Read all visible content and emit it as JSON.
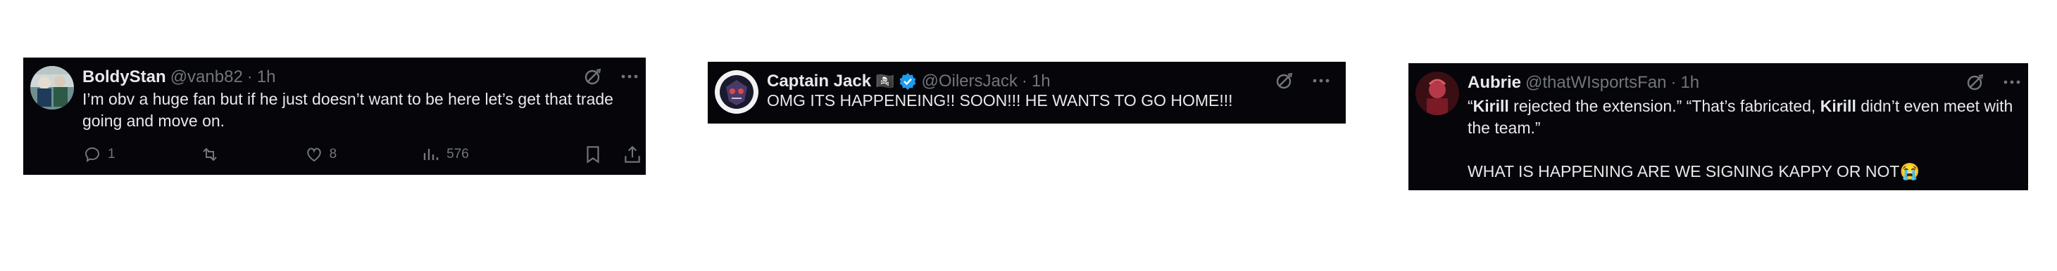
{
  "tweets": [
    {
      "name": "BoldyStan",
      "handle": "@vanb82",
      "separator": "·",
      "time": "1h",
      "text": "I’m obv a huge fan but if he just doesn’t want to be here let’s get that trade going and move on.",
      "metrics": {
        "replies": "1",
        "likes": "8",
        "views": "576"
      }
    },
    {
      "name": "Captain Jack",
      "name_badge": "🏴‍☠️",
      "handle": "@OilersJack",
      "separator": "·",
      "time": "1h",
      "verified": true,
      "text": "OMG ITS HAPPENEING!! SOON!!! HE WANTS TO GO HOME!!!"
    },
    {
      "name": "Aubrie",
      "handle": "@thatWIsportsFan",
      "separator": "·",
      "time": "1h",
      "text_parts": {
        "q1_open": "“",
        "kirill_1": "Kirill",
        "q1_rest": " rejected the extension.” “That’s fabricated, ",
        "kirill_2": "Kirill",
        "q2_rest": " didn’t even meet with the team.”",
        "line2": "WHAT IS HAPPENING ARE WE SIGNING KAPPY OR NOT",
        "emoji": "😭"
      }
    }
  ],
  "icons": {
    "grok": "grok-icon",
    "more": "more-icon",
    "reply": "reply-icon",
    "repost": "repost-icon",
    "like": "like-icon",
    "views": "views-icon",
    "bookmark": "bookmark-icon",
    "share": "share-icon",
    "verified": "verified-badge-icon"
  },
  "colors": {
    "background": "#05050a",
    "text": "#e7e9ea",
    "muted": "#71767b",
    "verified": "#1d9bf0"
  }
}
